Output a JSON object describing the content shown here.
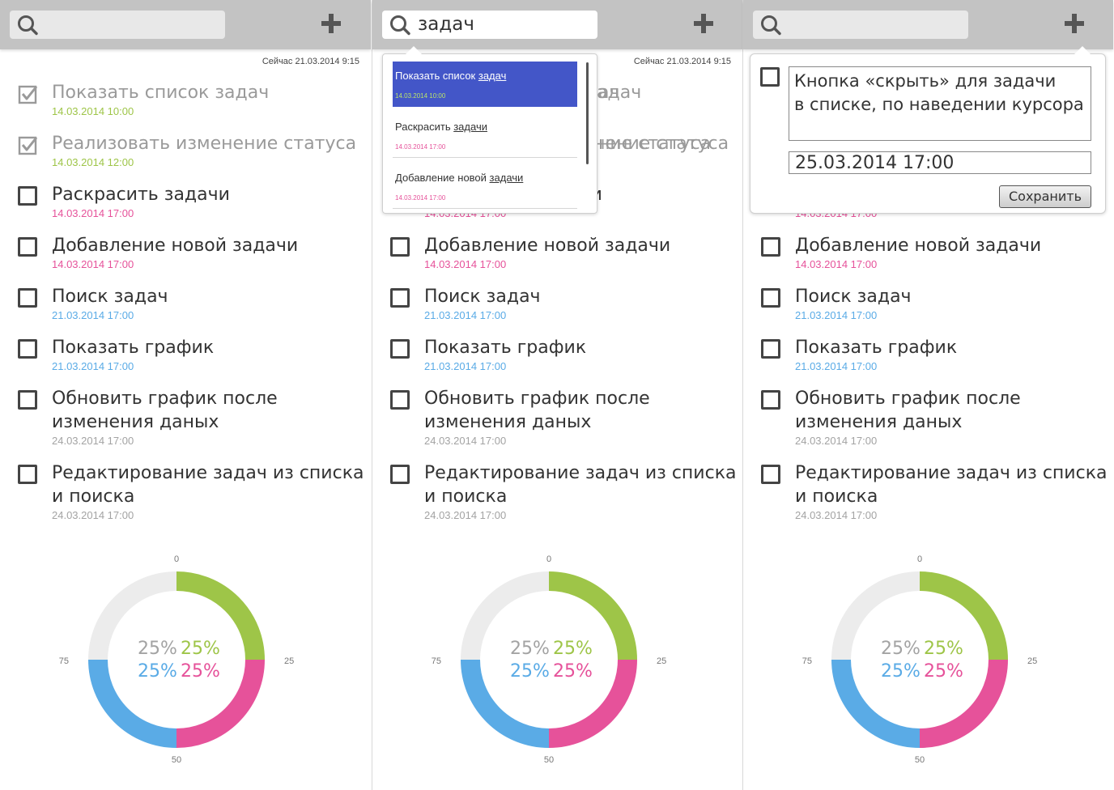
{
  "search_icon": "search-icon",
  "add_icon": "plus-icon",
  "columns": [
    {
      "search_query": "",
      "now_label": ""
    },
    {
      "search_query": "задач",
      "now_label": "Сейчас 21.03.2014 9:15"
    },
    {
      "search_query": "",
      "now_label": ""
    }
  ],
  "now_label": "Сейчас 21.03.2014 9:15",
  "colors": {
    "green": "#9ec548",
    "pink": "#e6529a",
    "blue": "#5aabe6",
    "gray": "#a3a3a3",
    "track": "#ececec",
    "topbar": "#c3c3c3",
    "selection": "#4356c8"
  },
  "tasks": [
    {
      "title": "Показать список задач",
      "date": "14.03.2014 10:00",
      "done": true,
      "color": "green"
    },
    {
      "title": "Реализовать изменение статуса",
      "date": "14.03.2014 12:00",
      "done": true,
      "color": "green"
    },
    {
      "title": "Раскрасить задачи",
      "date": "14.03.2014 17:00",
      "done": false,
      "color": "pink"
    },
    {
      "title": "Добавление новой задачи",
      "date": "14.03.2014 17:00",
      "done": false,
      "color": "pink"
    },
    {
      "title": "Поиск задач",
      "date": "21.03.2014 17:00",
      "done": false,
      "color": "blue"
    },
    {
      "title": "Показать график",
      "date": "21.03.2014 17:00",
      "done": false,
      "color": "blue"
    },
    {
      "title": "Обновить график после\nизменения даных",
      "date": "24.03.2014 17:00",
      "done": false,
      "color": "gray"
    },
    {
      "title": "Редактирование задач из списка\nи поиска",
      "date": "24.03.2014 17:00",
      "done": false,
      "color": "gray"
    }
  ],
  "chart_data": {
    "type": "pie",
    "style": "donut",
    "axis_labels": [
      "0",
      "25",
      "50",
      "75"
    ],
    "series": [
      {
        "value": 25,
        "label": "25%",
        "color": "green"
      },
      {
        "value": 25,
        "label": "25%",
        "color": "pink"
      },
      {
        "value": 25,
        "label": "25%",
        "color": "blue"
      },
      {
        "value": 25,
        "label": "25%",
        "color": "gray"
      }
    ]
  },
  "search_dropdown": {
    "items": [
      {
        "pre": "Показать список ",
        "match": "задач",
        "date": "14.03.2014 10:00",
        "selected": true
      },
      {
        "pre": "Раскрасить ",
        "match": "задачи",
        "date": "14.03.2014 17:00",
        "selected": false
      },
      {
        "pre": "Добавление новой ",
        "match": "задачи",
        "date": "14.03.2014 17:00",
        "selected": false
      }
    ],
    "peek_1": "ач",
    "peek_2": "ние статуса"
  },
  "editor": {
    "text": "Кнопка «скрыть» для задачи\nв списке, по наведении курсора",
    "date": "25.03.2014 17:00",
    "save_label": "Сохранить"
  },
  "peek_row": "14.03.2014 17:00"
}
